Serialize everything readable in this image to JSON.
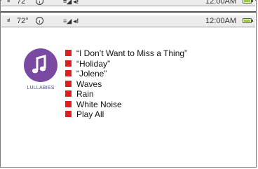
{
  "status_bar": {
    "signal": "ıııl",
    "temperature": "72°",
    "alert": "!",
    "sound": "=◢ ◂!",
    "time": "12:00AM"
  },
  "album": {
    "label": "LULLABIES"
  },
  "playlist": {
    "items": [
      "“I Don’t Want to Miss a Thing”",
      "“Holiday”",
      "“Jolene”",
      "Waves",
      "Rain",
      "White Noise",
      "Play All"
    ]
  },
  "colors": {
    "accent": "#e01e1e",
    "album_bg": "#7a4aa3"
  }
}
